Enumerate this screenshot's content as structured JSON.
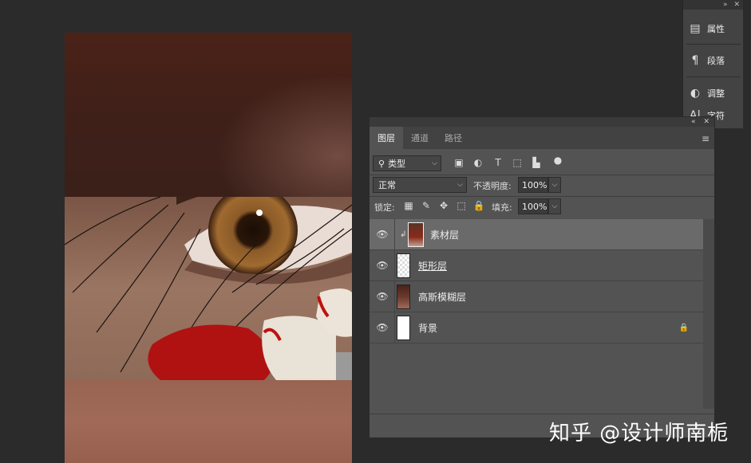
{
  "side_dock": {
    "items": [
      {
        "label": "属性",
        "icon": "properties-icon"
      },
      {
        "label": "段落",
        "icon": "paragraph-icon"
      },
      {
        "label": "调整",
        "icon": "adjustments-icon"
      },
      {
        "label": "字符",
        "icon": "character-icon"
      }
    ]
  },
  "layers_panel": {
    "tabs": [
      "图层",
      "通道",
      "路径"
    ],
    "active_tab": "图层",
    "filter_kind": "类型",
    "blend_mode": "正常",
    "opacity_label": "不透明度:",
    "opacity_value": "100%",
    "lock_label": "锁定:",
    "fill_label": "填充:",
    "fill_value": "100%",
    "layers": [
      {
        "name": "素材层",
        "selected": true,
        "clipped": true,
        "visible": true
      },
      {
        "name": "矩形层",
        "selected": false,
        "visible": true
      },
      {
        "name": "高斯模糊层",
        "selected": false,
        "visible": true
      },
      {
        "name": "背景",
        "selected": false,
        "visible": true,
        "locked": true
      }
    ]
  },
  "watermark": "知乎 @设计师南栀"
}
